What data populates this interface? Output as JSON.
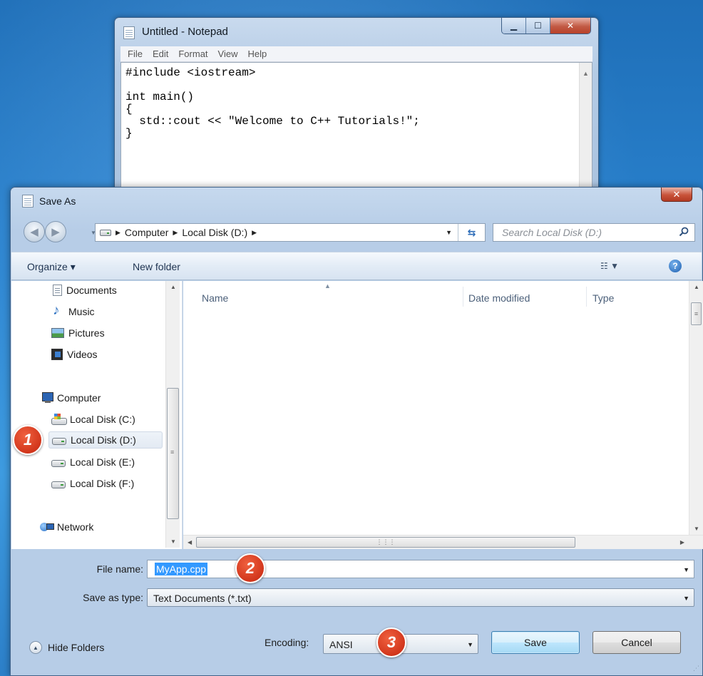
{
  "notepad": {
    "title": "Untitled - Notepad",
    "menu": [
      "File",
      "Edit",
      "Format",
      "View",
      "Help"
    ],
    "code": "#include <iostream>\n\nint main()\n{\n  std::cout << \"Welcome to C++ Tutorials!\";\n}"
  },
  "dialog": {
    "title": "Save As",
    "breadcrumb": [
      "Computer",
      "Local Disk (D:)"
    ],
    "search_placeholder": "Search Local Disk (D:)",
    "toolbar": {
      "organize": "Organize ▾",
      "new_folder": "New folder"
    },
    "nav": {
      "libraries": [
        {
          "label": "Documents",
          "icon": "documents-icon"
        },
        {
          "label": "Music",
          "icon": "music-icon"
        },
        {
          "label": "Pictures",
          "icon": "pictures-icon"
        },
        {
          "label": "Videos",
          "icon": "videos-icon"
        }
      ],
      "computer": "Computer",
      "drives": [
        "Local Disk (C:)",
        "Local Disk (D:)",
        "Local Disk (E:)",
        "Local Disk (F:)"
      ],
      "selected_drive": "Local Disk (D:)",
      "network": "Network"
    },
    "columns": [
      "Name",
      "Date modified",
      "Type"
    ],
    "file_name_label": "File name:",
    "file_name_value": "MyApp.cpp",
    "save_type_label": "Save as type:",
    "save_type_value": "Text Documents (*.txt)",
    "hide_folders": "Hide Folders",
    "encoding_label": "Encoding:",
    "encoding_value": "ANSI",
    "save_button": "Save",
    "cancel_button": "Cancel"
  },
  "annotations": {
    "step1": "1",
    "step2": "2",
    "step3": "3"
  },
  "colors": {
    "accent": "#3399ff",
    "badge": "#d2361c",
    "close": "#c8533a"
  }
}
